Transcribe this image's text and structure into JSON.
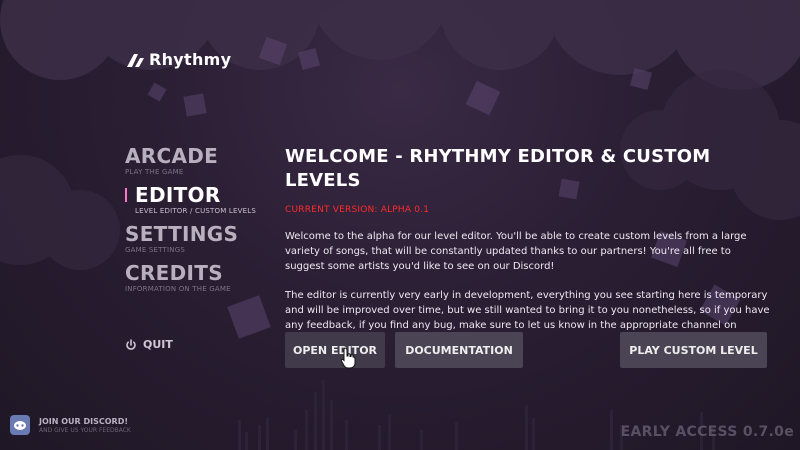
{
  "logo": {
    "text": "Rhythmy"
  },
  "menu": {
    "items": [
      {
        "title": "ARCADE",
        "subtitle": "PLAY THE GAME"
      },
      {
        "title": "EDITOR",
        "subtitle": "LEVEL EDITOR / CUSTOM LEVELS"
      },
      {
        "title": "SETTINGS",
        "subtitle": "GAME SETTINGS"
      },
      {
        "title": "CREDITS",
        "subtitle": "INFORMATION ON THE GAME"
      }
    ],
    "active": "EDITOR",
    "quit_label": "QUIT"
  },
  "content": {
    "heading": "WELCOME - RHYTHMY EDITOR & CUSTOM LEVELS",
    "version": "CURRENT VERSION: ALPHA 0.1",
    "paragraph_1": "Welcome to the alpha for our level editor. You'll be able to create custom levels from a large variety of songs, that will be constantly updated thanks to our partners! You're all free to suggest some artists you'd like to see on our Discord!",
    "paragraph_2": "The editor is currently very early in development, everything you see starting here is temporary and will be improved over time, but we still wanted to bring it to you nonetheless, so if you have any feedback, if you find any bug, make sure to let us know in the appropriate channel on Discord!"
  },
  "buttons": {
    "open_editor": "OPEN EDITOR",
    "documentation": "DOCUMENTATION",
    "play_custom": "PLAY CUSTOM LEVEL"
  },
  "discord": {
    "title": "JOIN OUR DISCORD!",
    "subtitle": "AND GIVE US YOUR FEEDBACK"
  },
  "build": "EARLY ACCESS 0.7.0e",
  "colors": {
    "accent": "#ff77c4",
    "version_red": "#ff2b2b",
    "button_bg": "#4b4454"
  }
}
